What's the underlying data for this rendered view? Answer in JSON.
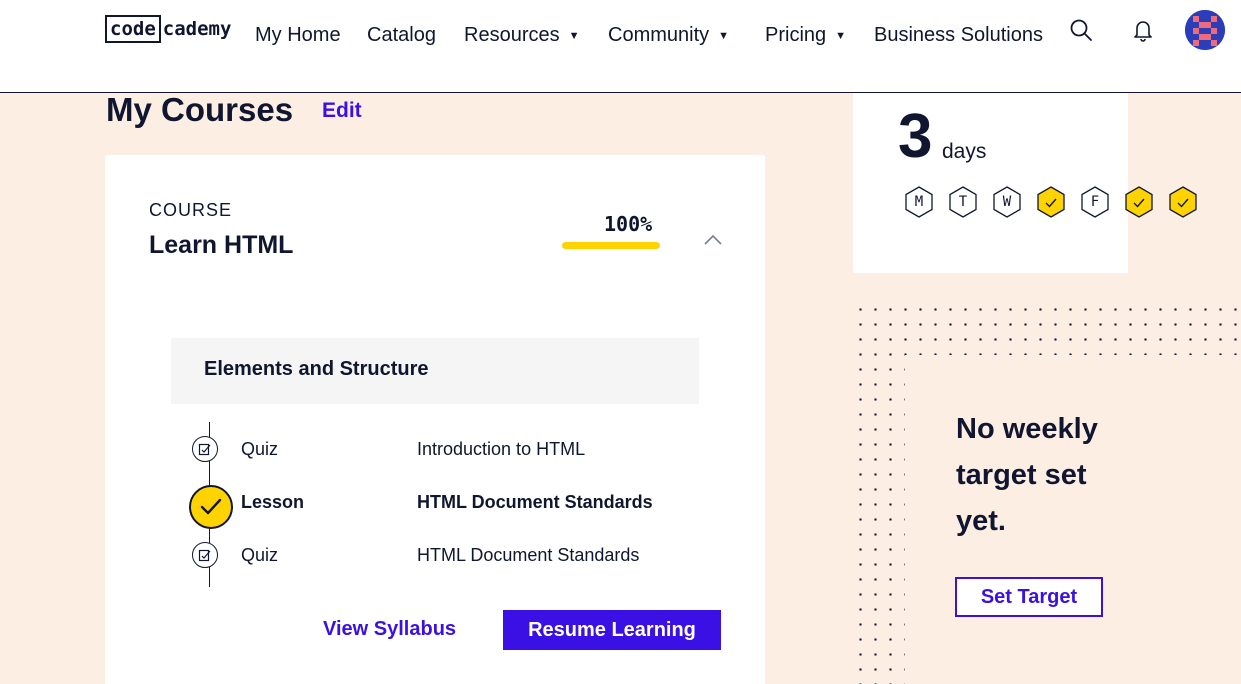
{
  "brand": {
    "logo_box": "code",
    "logo_rest": "cademy"
  },
  "nav": {
    "my_home": "My Home",
    "catalog": "Catalog",
    "resources": "Resources",
    "community": "Community",
    "pricing": "Pricing",
    "business": "Business Solutions",
    "caret": "▼",
    "icons": [
      "search-icon",
      "bell-icon",
      "avatar"
    ]
  },
  "page": {
    "title": "My Courses",
    "edit": "Edit"
  },
  "course": {
    "eyebrow": "COURSE",
    "name": "Learn HTML",
    "progress_label": "100%",
    "progress": 1.0,
    "module": "Elements and Structure",
    "items": [
      {
        "type": "Quiz",
        "title": "Introduction to HTML",
        "done": false
      },
      {
        "type": "Lesson",
        "title": "HTML Document Standards",
        "done": true
      },
      {
        "type": "Quiz",
        "title": "HTML Document Standards",
        "done": false
      }
    ],
    "view_syllabus": "View Syllabus",
    "resume": "Resume Learning"
  },
  "streak": {
    "count": "3",
    "unit": "days",
    "days": [
      {
        "letter": "M",
        "done": false
      },
      {
        "letter": "T",
        "done": false
      },
      {
        "letter": "W",
        "done": false
      },
      {
        "letter": "",
        "done": true
      },
      {
        "letter": "F",
        "done": false
      },
      {
        "letter": "",
        "done": true
      },
      {
        "letter": "",
        "done": true
      }
    ]
  },
  "target": {
    "message": "No weekly target set yet.",
    "button": "Set Target"
  },
  "colors": {
    "accent": "#3a10e5",
    "yellow": "#ffd300",
    "navy": "#10162f",
    "bg": "#fdeee4"
  }
}
